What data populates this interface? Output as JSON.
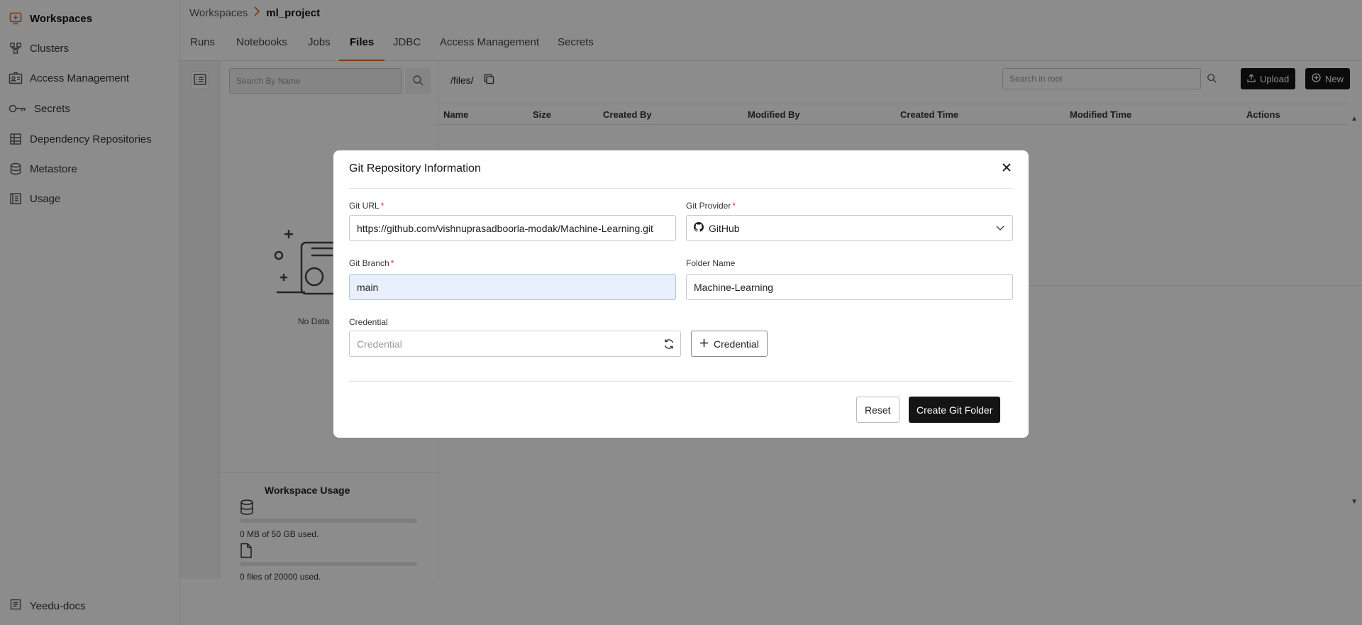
{
  "sidebar": {
    "items": [
      {
        "label": "Workspaces",
        "icon": "workspace-icon",
        "active": true
      },
      {
        "label": "Clusters",
        "icon": "clusters-icon"
      },
      {
        "label": "Access Management",
        "icon": "access-management-icon"
      },
      {
        "label": "Secrets",
        "icon": "key-icon"
      },
      {
        "label": "Dependency Repositories",
        "icon": "dependency-icon"
      },
      {
        "label": "Metastore",
        "icon": "database-icon"
      },
      {
        "label": "Usage",
        "icon": "usage-icon"
      }
    ],
    "footer_label": "Yeedu-docs"
  },
  "breadcrumb": {
    "parent": "Workspaces",
    "current": "ml_project"
  },
  "tabs": [
    "Runs",
    "Notebooks",
    "Jobs",
    "Files",
    "JDBC",
    "Access Management",
    "Secrets"
  ],
  "active_tab": "Files",
  "files_tree": {
    "search_placeholder": "Search By Name",
    "empty_text": "No Data",
    "usage": {
      "title": "Workspace Usage",
      "storage_text": "0 MB of 50 GB used.",
      "storage_fraction": 0,
      "files_text": "0 files of 20000 used.",
      "files_fraction": 0
    }
  },
  "main": {
    "path": "/files/",
    "search_placeholder": "Search in root",
    "upload_label": "Upload",
    "new_label": "New",
    "columns": [
      "Name",
      "Size",
      "Created By",
      "Modified By",
      "Created Time",
      "Modified Time",
      "Actions"
    ]
  },
  "modal": {
    "title": "Git Repository Information",
    "git_url_label": "Git URL",
    "git_url_value": "https://github.com/vishnuprasadboorla-modak/Machine-Learning.git",
    "git_provider_label": "Git Provider",
    "git_provider_value": "GitHub",
    "git_branch_label": "Git Branch",
    "git_branch_value": "main",
    "folder_name_label": "Folder Name",
    "folder_name_value": "Machine-Learning",
    "credential_label": "Credential",
    "credential_placeholder": "Credential",
    "add_credential_label": "Credential",
    "reset_label": "Reset",
    "create_label": "Create Git Folder"
  },
  "colors": {
    "accent": "#e0661b",
    "primary_button": "#141414",
    "autofill": "#e8f0fe"
  }
}
